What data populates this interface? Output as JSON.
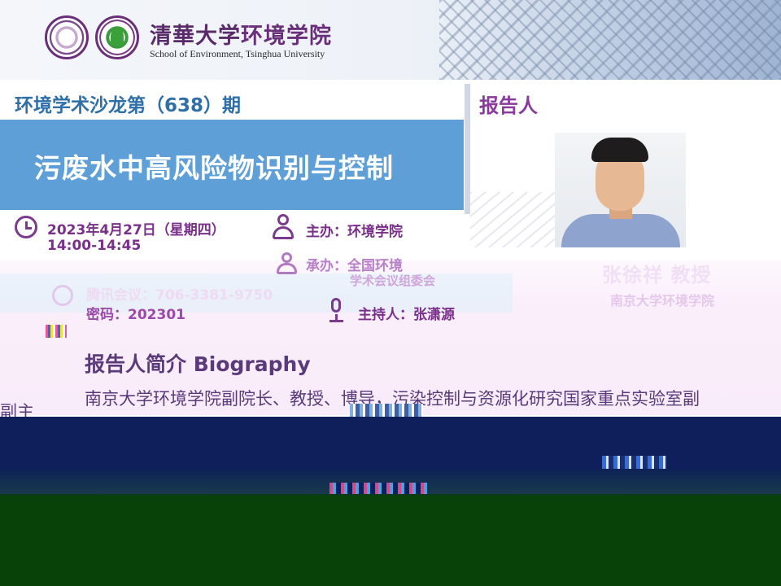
{
  "header": {
    "school_cn_part1": "清華大学",
    "school_cn_part2": "环境学院",
    "school_en": "School of Environment, Tsinghua University"
  },
  "event": {
    "series": "环境学术沙龙第（638）期",
    "title": "污废水中高风险物识别与控制",
    "date": "2023年4月27日（星期四）",
    "time": "14:00-14:45",
    "host": "主办：环境学院",
    "organizer_line1": "承办：全国环境",
    "organizer_line2": "学术会议组委会",
    "meeting": "腾讯会议：706-3381-9750",
    "password": "密码：202301",
    "chair": "主持人：张潇源"
  },
  "speaker": {
    "section_label": "报告人",
    "name": "张徐祥 教授",
    "affiliation": "南京大学环境学院"
  },
  "bio": {
    "title_cn": "报告人简介",
    "title_en": "Biography",
    "text": "南京大学环境学院副院长、教授、博导，污染控制与资源化研究国家重点实验室副",
    "cut_line": "副主"
  },
  "colors": {
    "title_band": "#5e9fd8",
    "accent_purple": "#7a2f8a",
    "series_blue": "#2f6fa8",
    "navy": "#0e1f5c",
    "green": "#084208"
  }
}
